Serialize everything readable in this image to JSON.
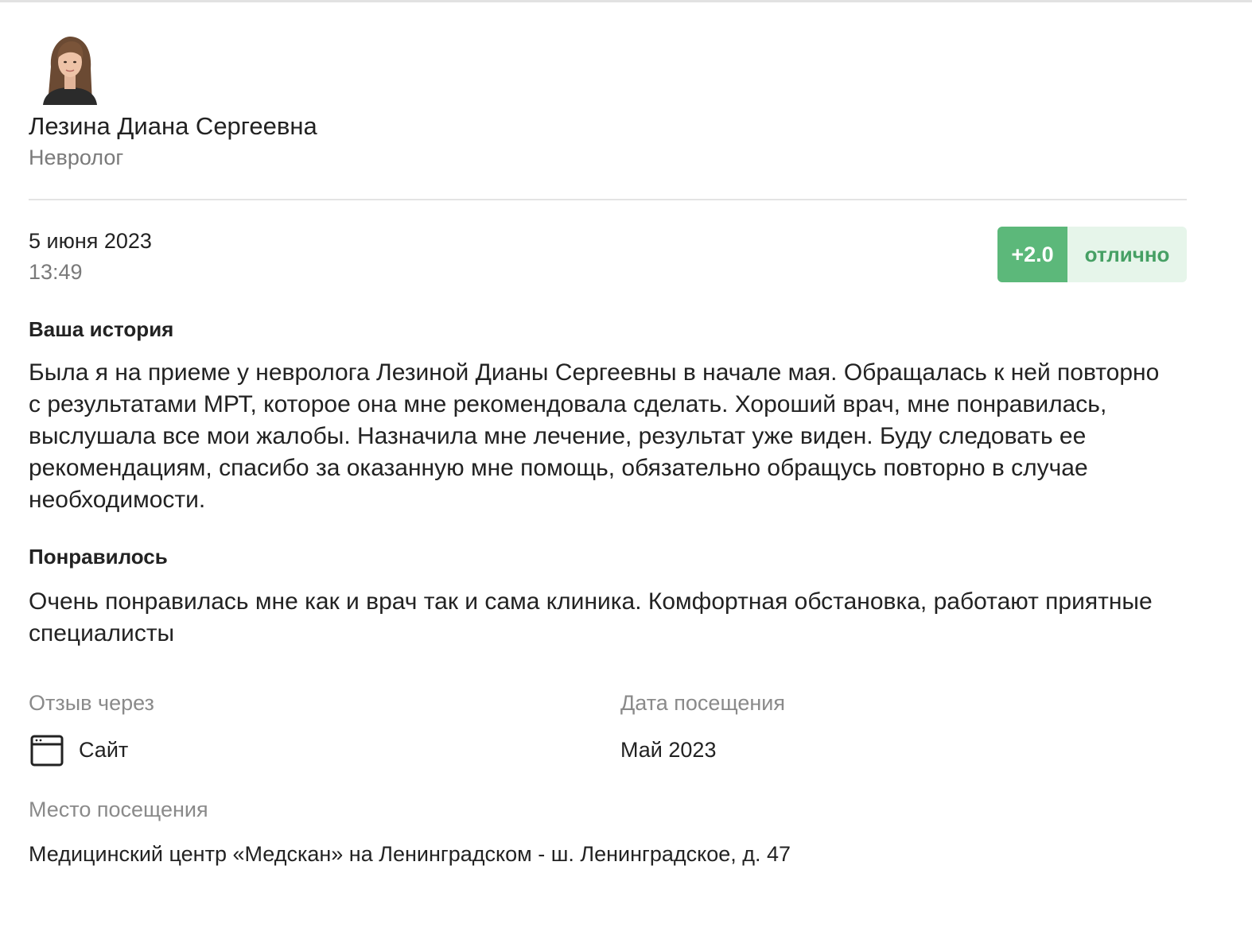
{
  "doctor": {
    "name": "Лезина Диана Сергеевна",
    "specialty": "Невролог"
  },
  "review": {
    "date": "5 июня 2023",
    "time": "13:49",
    "rating": {
      "score": "+2.0",
      "label": "отлично",
      "score_color": "#5cb87a",
      "label_color": "#46a064"
    },
    "story": {
      "title": "Ваша история",
      "text": "Была я на приеме у невролога Лезиной Дианы Сергеевны в начале мая. Обращалась к ней повторно с результатами МРТ, которое она мне рекомендовала сделать. Хороший врач, мне понравилась, выслушала все мои жалобы. Назначила мне лечение, результат уже виден. Буду следовать ее рекомендациям, спасибо за оказанную мне помощь, обязательно обращусь повторно в случае необходимости."
    },
    "liked": {
      "title": "Понравилось",
      "text": "Очень понравилась мне как и врач так и сама клиника. Комфортная обстановка, работают приятные специалисты"
    },
    "source": {
      "label": "Отзыв через",
      "value": "Сайт",
      "icon": "browser-window-icon"
    },
    "visit_date": {
      "label": "Дата посещения",
      "value": "Май 2023"
    },
    "visit_place": {
      "label": "Место посещения",
      "value": "Медицинский центр «Медскан» на Ленинградском - ш. Ленинградское, д. 47"
    }
  }
}
